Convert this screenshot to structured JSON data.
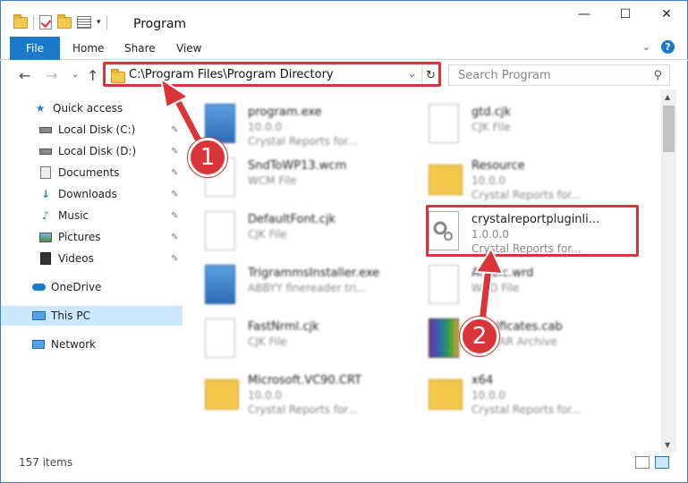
{
  "window": {
    "title": "Program",
    "minimize": "—",
    "maximize": "☐",
    "close": "✕"
  },
  "ribbon": {
    "tabs": [
      "File",
      "Home",
      "Share",
      "View"
    ],
    "collapse": "⌄",
    "help": "?"
  },
  "nav": {
    "back": "←",
    "forward": "→",
    "recent": "⌄",
    "up": "↑",
    "address": "C:\\Program Files\\Program Directory",
    "address_dropdown": "⌄",
    "refresh": "↻",
    "search_placeholder": "Search Program",
    "search_icon": "⚲"
  },
  "sidebar": {
    "items": [
      {
        "label": "Quick access",
        "icon": "star-icon",
        "pinned": false
      },
      {
        "label": "Local Disk (C:)",
        "icon": "drive-icon",
        "pinned": true
      },
      {
        "label": "Local Disk (D:)",
        "icon": "drive-icon",
        "pinned": true
      },
      {
        "label": "Documents",
        "icon": "documents-icon",
        "pinned": true
      },
      {
        "label": "Downloads",
        "icon": "download-icon",
        "pinned": true
      },
      {
        "label": "Music",
        "icon": "music-icon",
        "pinned": true
      },
      {
        "label": "Pictures",
        "icon": "pictures-icon",
        "pinned": true
      },
      {
        "label": "Videos",
        "icon": "video-icon",
        "pinned": true
      },
      {
        "label": "OneDrive",
        "icon": "cloud-icon",
        "pinned": false
      },
      {
        "label": "This PC",
        "icon": "computer-icon",
        "pinned": false,
        "selected": true
      },
      {
        "label": "Network",
        "icon": "network-icon",
        "pinned": false
      }
    ],
    "pin_glyph": "📌"
  },
  "files": [
    {
      "name": "program.exe",
      "line2": "10.0.0",
      "line3": "Crystal Reports for...",
      "icon": "exe"
    },
    {
      "name": "gtd.cjk",
      "line2": "CJK File",
      "line3": "",
      "icon": "doc"
    },
    {
      "name": "SndToWP13.wcm",
      "line2": "WCM File",
      "line3": "",
      "icon": "doc"
    },
    {
      "name": "Resource",
      "line2": "10.0.0",
      "line3": "Crystal Reports for...",
      "icon": "folder"
    },
    {
      "name": "DefaultFont.cjk",
      "line2": "CJK File",
      "line3": "",
      "icon": "doc"
    },
    {
      "name": "crystalreportpluginli...",
      "line2": "1.0.0.0",
      "line3": "Crystal Reports for...",
      "icon": "gear"
    },
    {
      "name": "TrigrammsInstaller.exe",
      "line2": "ABBYY finereader tri...",
      "line3": "",
      "icon": "exe"
    },
    {
      "name": "Arabic.wrd",
      "line2": "WRD File",
      "line3": "",
      "icon": "doc"
    },
    {
      "name": "FastNrml.cjk",
      "line2": "CJK File",
      "line3": "",
      "icon": "doc"
    },
    {
      "name": "Certificates.cab",
      "line2": "WinRAR Archive",
      "line3": "",
      "icon": "rar"
    },
    {
      "name": "Microsoft.VC90.CRT",
      "line2": "10.0.0",
      "line3": "Crystal Reports for...",
      "icon": "folder"
    },
    {
      "name": "x64",
      "line2": "10.0.0",
      "line3": "Crystal Reports for...",
      "icon": "folder"
    }
  ],
  "status": {
    "count": "157 items"
  },
  "annotations": {
    "step1": "1",
    "step2": "2",
    "highlight_color": "#d9343a"
  },
  "colors": {
    "accent": "#1979ca",
    "selection": "#cce8ff",
    "border": "#3d7bd0"
  }
}
